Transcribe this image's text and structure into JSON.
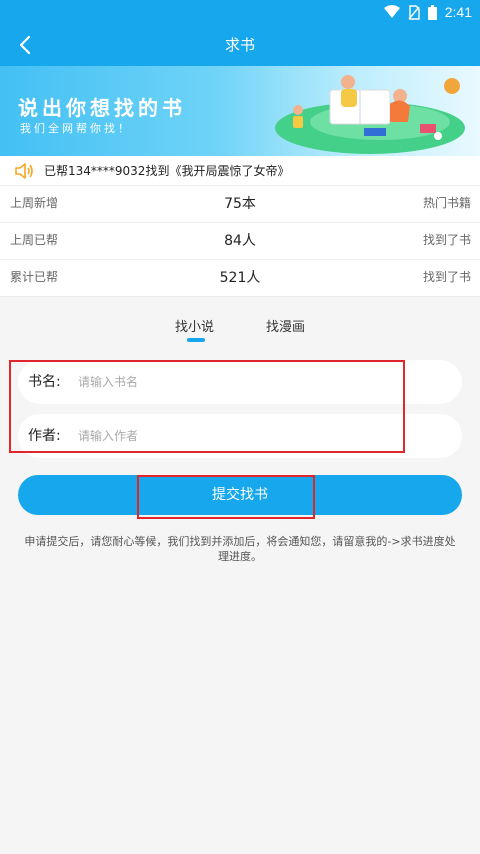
{
  "status_bar": {
    "time": "2:41",
    "icons": [
      "wifi-icon",
      "no-sim-icon",
      "battery-icon"
    ]
  },
  "nav": {
    "title": "求书",
    "back_icon": "back-arrow-icon"
  },
  "banner": {
    "title": "说出你想找的书",
    "subtitle": "我们全网帮你找！"
  },
  "notice": {
    "icon": "speaker-icon",
    "text": "已帮134****9032找到《我开局震惊了女帝》"
  },
  "stats": [
    {
      "label": "上周新增",
      "value": "75本",
      "link": "热门书籍"
    },
    {
      "label": "上周已帮",
      "value": "84人",
      "link": "找到了书"
    },
    {
      "label": "累计已帮",
      "value": "521人",
      "link": "找到了书"
    }
  ],
  "tabs": {
    "novel": "找小说",
    "comic": "找漫画",
    "active": "novel"
  },
  "form": {
    "book_name_label": "书名:",
    "book_name_placeholder": "请输入书名",
    "author_label": "作者:",
    "author_placeholder": "请输入作者",
    "submit_label": "提交找书"
  },
  "hint": "申请提交后，请您耐心等候，我们找到并添加后，将会通知您，请留意我的->求书进度处理进度。",
  "colors": {
    "primary": "#16a7ec",
    "highlight": "#e0262b",
    "background": "#f5f5f5"
  }
}
